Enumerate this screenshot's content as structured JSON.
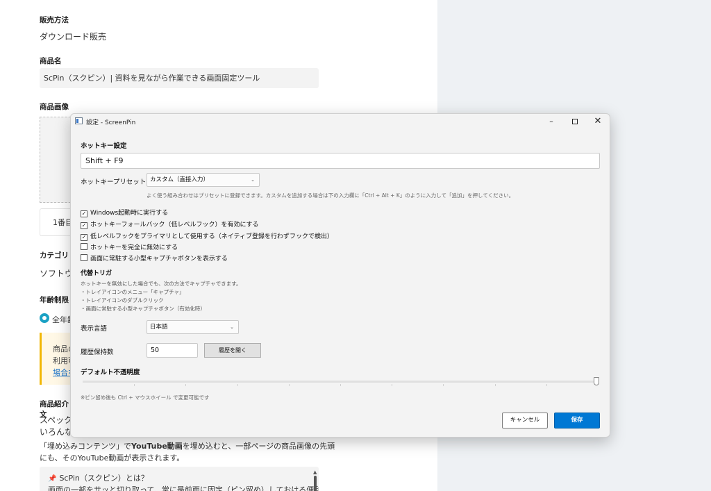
{
  "background_page": {
    "sales_method_label": "販売方法",
    "sales_method_value": "ダウンロード販売",
    "product_name_label": "商品名",
    "product_name_value": "ScPin（スクピン）| 資料を見ながら作業できる画面固定ツール",
    "product_image_label": "商品画像",
    "image_order_text": "1番目",
    "category_label": "カテゴリ",
    "category_value": "ソフトウ",
    "age_limit_label": "年齢制限",
    "age_option": "全年齢",
    "notice_line1": "商品の",
    "notice_line2": "利用可",
    "notice_link": "場合な",
    "intro_label": "商品紹介文",
    "intro_line1": "スペック",
    "intro_line2": "いろんな",
    "embed_line1_a": "「埋め込みコンテンツ」で",
    "embed_line1_b": "YouTube動画",
    "embed_line1_c": "を埋め込むと、一部ページの商品画像の先頭",
    "embed_line2": "にも、そのYouTube動画が表示されます。",
    "content_line1": "ScPin（スクピン）とは？",
    "content_line2": "画面の一部をサッと切り取って、常に最前面に固定（ピン留め）しておける便利"
  },
  "dialog": {
    "title": "設定 - ScreenPin",
    "minimize": "–",
    "close": "✕",
    "hotkey_section": "ホットキー設定",
    "hotkey_value": "Shift + F9",
    "preset_label": "ホットキープリセット",
    "preset_value": "カスタム（直接入力）",
    "preset_help": "よく使う組み合わせはプリセットに登録できます。カスタムを追加する場合は下の入力欄に「Ctrl + Alt + K」のように入力して「追加」を押してください。",
    "checkboxes": [
      {
        "label": "Windows起動時に実行する",
        "checked": true
      },
      {
        "label": "ホットキーフォールバック（低レベルフック）を有効にする",
        "checked": true
      },
      {
        "label": "低レベルフックをプライマリとして使用する（ネイティブ登録を行わずフックで検出）",
        "checked": true
      },
      {
        "label": "ホットキーを完全に無効にする",
        "checked": false
      },
      {
        "label": "画面に常駐する小型キャプチャボタンを表示する",
        "checked": false
      }
    ],
    "alt_trigger_section": "代替トリガ",
    "alt_trigger_lines": [
      "ホットキーを無効にした場合でも、次の方法でキャプチャできます。",
      "・トレイアイコンのメニュー「キャプチャ」",
      "・トレイアイコンのダブルクリック",
      "・画面に常駐する小型キャプチャボタン（有効化時）"
    ],
    "language_label": "表示言語",
    "language_value": "日本語",
    "history_label": "履歴保持数",
    "history_value": "50",
    "history_button": "履歴を開く",
    "opacity_section": "デフォルト不透明度",
    "opacity_value": 1.0,
    "opacity_note": "※ピン留め後も Ctrl + マウスホイール で変更可能です",
    "cancel_button": "キャンセル",
    "save_button": "保存"
  },
  "colors": {
    "accent": "#0078d4",
    "radio": "#1aa1c4",
    "notice_border": "#f2b705",
    "right_panel": "#eef1f4"
  }
}
